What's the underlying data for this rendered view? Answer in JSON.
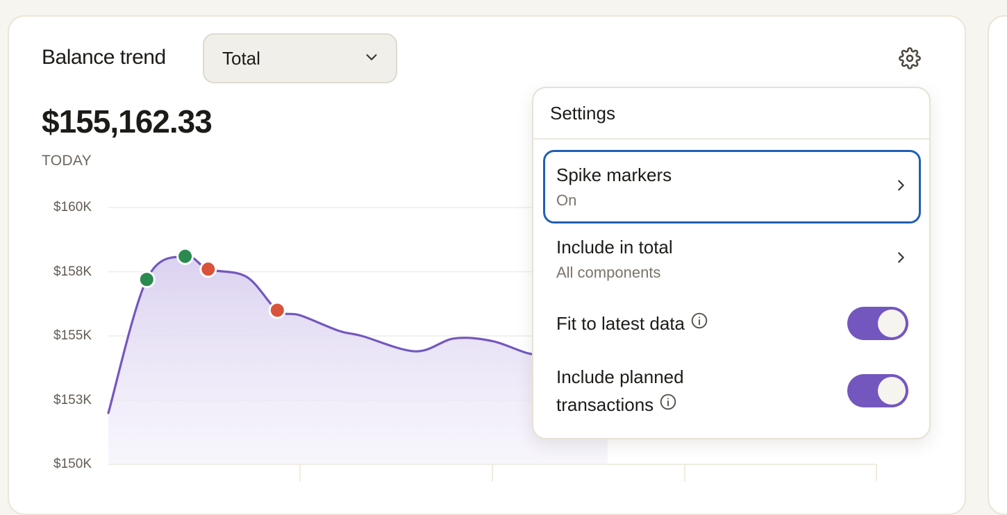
{
  "widget": {
    "title": "Balance trend",
    "period_select": {
      "value": "Total"
    },
    "settings_icon": "gear-icon",
    "balance": "$155,162.33",
    "balance_label": "TODAY"
  },
  "chart_data": {
    "type": "area",
    "y_tick_labels": [
      "$160K",
      "$158K",
      "$155K",
      "$153K",
      "$150K"
    ],
    "ylim": [
      150000,
      160000
    ],
    "grid": true,
    "x": [
      0,
      5,
      10,
      13,
      18,
      22,
      25,
      30,
      33,
      40,
      45,
      50,
      55,
      58,
      65
    ],
    "values": [
      152000,
      157200,
      158100,
      157600,
      157300,
      156000,
      155800,
      155200,
      155000,
      154400,
      154900,
      154800,
      154300,
      154400,
      154800
    ],
    "colors": {
      "line": "#7357bf",
      "fill": "#e4dcf3",
      "gain": "#2b8a4f",
      "loss": "#d9533a"
    },
    "markers": [
      {
        "x": 5,
        "value": 157200,
        "kind": "gain"
      },
      {
        "x": 10,
        "value": 158100,
        "kind": "gain"
      },
      {
        "x": 13,
        "value": 157600,
        "kind": "loss"
      },
      {
        "x": 22,
        "value": 156000,
        "kind": "loss"
      }
    ]
  },
  "settings_menu": {
    "title": "Settings",
    "items": [
      {
        "title": "Spike markers",
        "value": "On"
      },
      {
        "title": "Include in total",
        "value": "All components"
      }
    ],
    "toggles": [
      {
        "label_line1": "Fit to latest data",
        "label_line2": "",
        "on": true
      },
      {
        "label_line1": "Include planned",
        "label_line2": "transactions",
        "on": true
      }
    ]
  }
}
